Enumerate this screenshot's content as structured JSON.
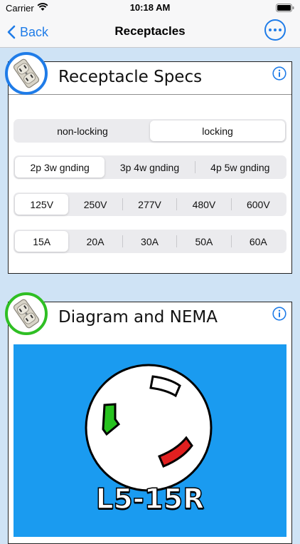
{
  "status_bar": {
    "carrier": "Carrier",
    "time": "10:18 AM"
  },
  "nav": {
    "back_label": "Back",
    "title": "Receptacles"
  },
  "specs_card": {
    "title": "Receptacle Specs",
    "type_control": {
      "options": [
        "non-locking",
        "locking"
      ],
      "selected": "locking"
    },
    "config_control": {
      "options": [
        "2p 3w gnding",
        "3p 4w gnding",
        "4p 5w gnding"
      ],
      "selected": "2p 3w gnding"
    },
    "voltage_control": {
      "options": [
        "125V",
        "250V",
        "277V",
        "480V",
        "600V"
      ],
      "selected": "125V"
    },
    "amperage_control": {
      "options": [
        "15A",
        "20A",
        "30A",
        "50A",
        "60A"
      ],
      "selected": "15A"
    }
  },
  "diagram_card": {
    "title": "Diagram and NEMA",
    "nema_label": "L5-15R",
    "colors": {
      "panel": "#1a9bf0",
      "hot": "#e02020",
      "ground": "#27c21f",
      "neutral": "#ffffff"
    }
  },
  "theme": {
    "accent": "#1f7ce8",
    "background": "#cfe3f5"
  }
}
